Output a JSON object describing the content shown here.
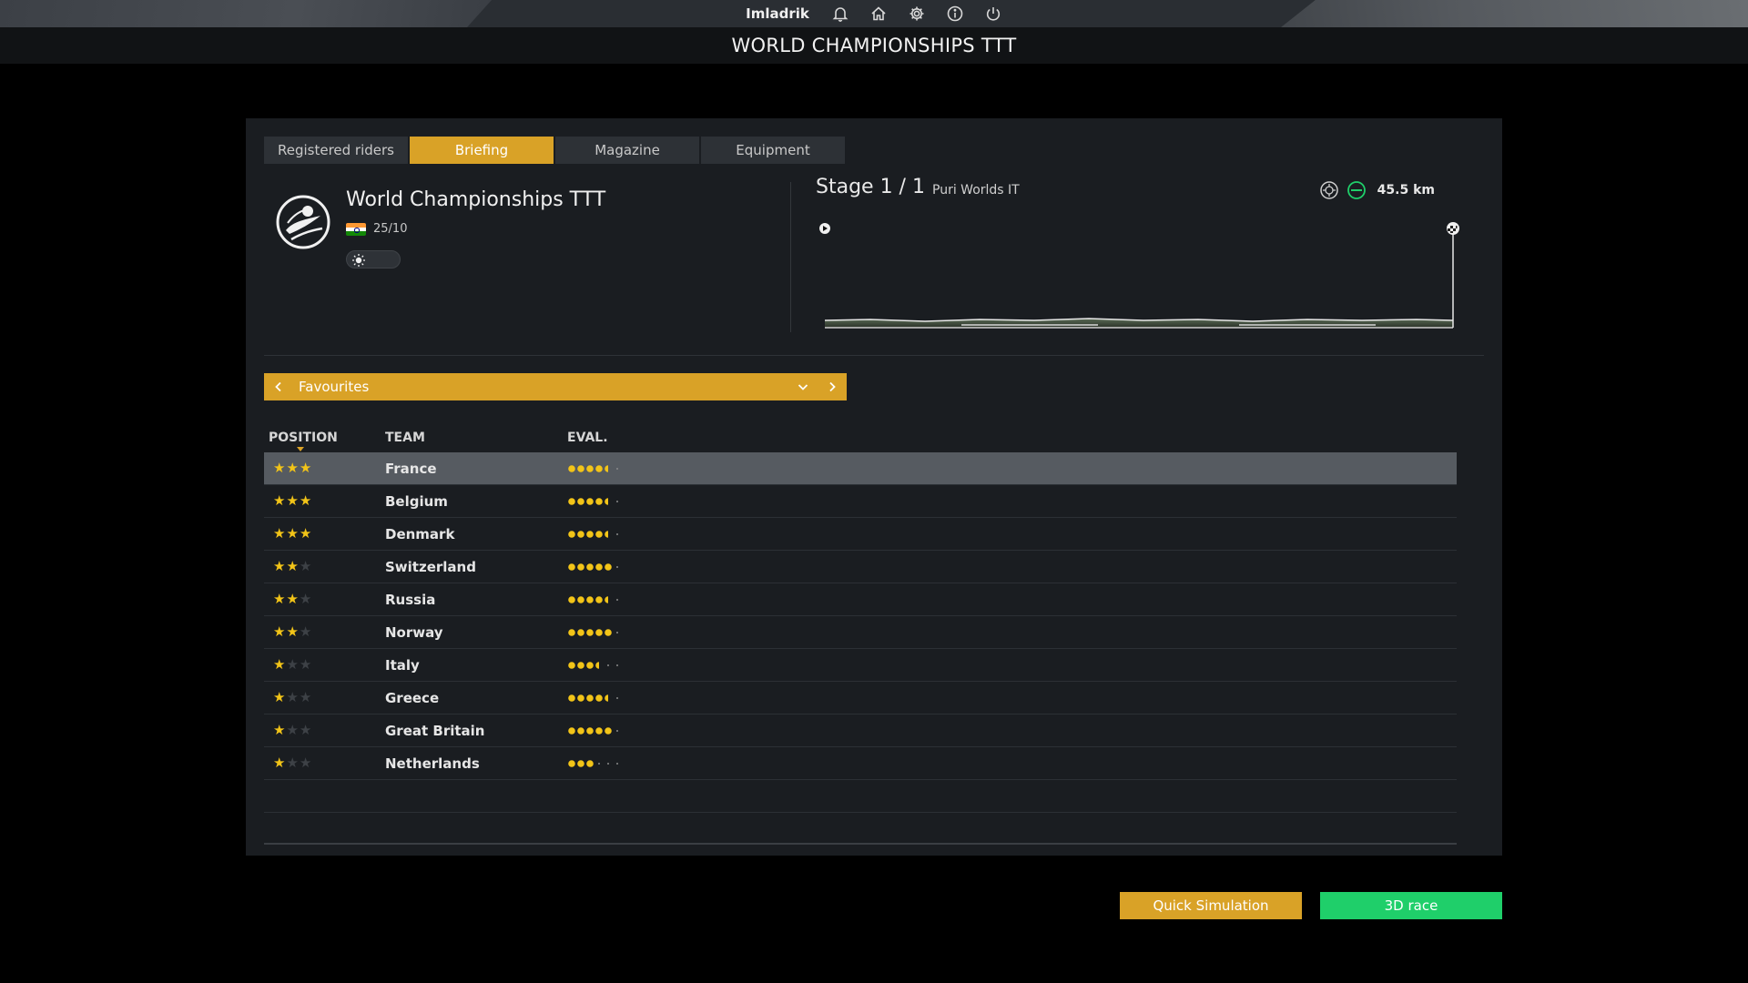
{
  "topbar": {
    "username": "Imladrik",
    "icons": [
      "bell-icon",
      "home-icon",
      "gear-icon",
      "info-icon",
      "power-icon"
    ]
  },
  "page_title": "WORLD CHAMPIONSHIPS TTT",
  "tabs": [
    {
      "label": "Registered riders",
      "active": false
    },
    {
      "label": "Briefing",
      "active": true
    },
    {
      "label": "Magazine",
      "active": false
    },
    {
      "label": "Equipment",
      "active": false
    }
  ],
  "race": {
    "name": "World Championships TTT",
    "date": "25/10",
    "flag": "india-flag-icon",
    "weather": "sun-icon"
  },
  "stage": {
    "label": "Stage 1 / 1",
    "name": "Puri Worlds IT",
    "distance": "45.5 km",
    "icons": [
      "team-time-trial-icon",
      "flat-stage-icon"
    ]
  },
  "selector": {
    "label": "Favourites"
  },
  "table": {
    "headers": {
      "position": "POSITION",
      "team": "TEAM",
      "eval": "EVAL."
    },
    "rows": [
      {
        "team": "France",
        "stars": 3,
        "eval": 4.5,
        "selected": true
      },
      {
        "team": "Belgium",
        "stars": 3,
        "eval": 4.5,
        "selected": false
      },
      {
        "team": "Denmark",
        "stars": 3,
        "eval": 4.5,
        "selected": false
      },
      {
        "team": "Switzerland",
        "stars": 2,
        "eval": 5,
        "selected": false
      },
      {
        "team": "Russia",
        "stars": 2,
        "eval": 4.5,
        "selected": false
      },
      {
        "team": "Norway",
        "stars": 2,
        "eval": 5,
        "selected": false
      },
      {
        "team": "Italy",
        "stars": 1,
        "eval": 3.5,
        "selected": false
      },
      {
        "team": "Greece",
        "stars": 1,
        "eval": 4.5,
        "selected": false
      },
      {
        "team": "Great Britain",
        "stars": 1,
        "eval": 5,
        "selected": false
      },
      {
        "team": "Netherlands",
        "stars": 1,
        "eval": 3,
        "selected": false
      }
    ],
    "max_stars": 3,
    "max_eval": 6
  },
  "buttons": {
    "quick_simulation": "Quick Simulation",
    "race_3d": "3D race"
  },
  "colors": {
    "accent": "#d9a227",
    "green": "#1fcf6a",
    "star": "#f2c418"
  }
}
